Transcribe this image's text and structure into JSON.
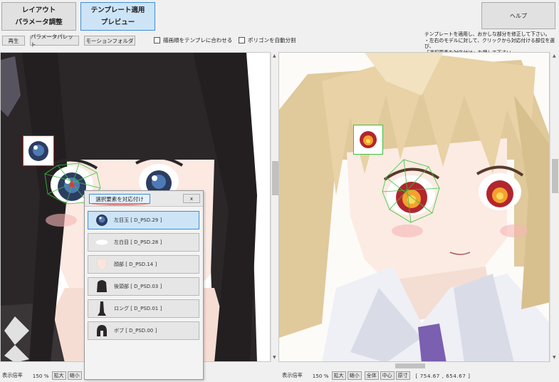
{
  "toolbar": {
    "layout_btn": {
      "line1": "レイアウト",
      "line2": "パラメータ調整"
    },
    "template_btn": {
      "line1": "テンプレート適用",
      "line2": "プレビュー"
    },
    "help": "ヘルプ",
    "play": "再生",
    "param_palette": "パラメータパレット",
    "motion_folder": "モーションフォルダ",
    "chk_draw_order": "描画順をテンプレに合わせる",
    "chk_auto_polygon": "ポリゴンを自動分割"
  },
  "instructions": [
    "テンプレートを適用し、おかしな部分を修正して下さい。",
    "・左右のモデルに対して、クリックから対応付ける部位を選び、",
    "「選択要素を対応付け」を押して下さい。"
  ],
  "popup": {
    "assign_label": "選択要素を対応付け",
    "close_label": "x",
    "items": [
      {
        "label": "左目玉 [ D_PSD.29 ]",
        "icon": "eyeball-icon",
        "selected": true
      },
      {
        "label": "左白目 [ D_PSD.28 ]",
        "icon": "eye-white-icon",
        "selected": false
      },
      {
        "label": "顔部 [ D_PSD.14 ]",
        "icon": "face-icon",
        "selected": false
      },
      {
        "label": "後頭部 [ D_PSD.03 ]",
        "icon": "back-hair-icon",
        "selected": false
      },
      {
        "label": "ロング [ D_PSD.01 ]",
        "icon": "long-hair-icon",
        "selected": false
      },
      {
        "label": "ボブ [ D_PSD.00 ]",
        "icon": "bob-hair-icon",
        "selected": false
      }
    ]
  },
  "status_left": {
    "zoom_label": "表示倍率",
    "zoom_value": "150 %",
    "zoom_in": "拡大",
    "zoom_out": "縮小"
  },
  "status_right": {
    "zoom_label": "表示倍率",
    "zoom_value": "150 %",
    "zoom_in": "拡大",
    "zoom_out": "縮小",
    "fit_all": "全体",
    "center": "中心",
    "original": "原寸",
    "coords": "[ 754.67 , 654.67 ]"
  },
  "colors": {
    "accent": "#3c8ed8",
    "selected_bg": "#cde4f7",
    "underline": "#dd2222"
  }
}
